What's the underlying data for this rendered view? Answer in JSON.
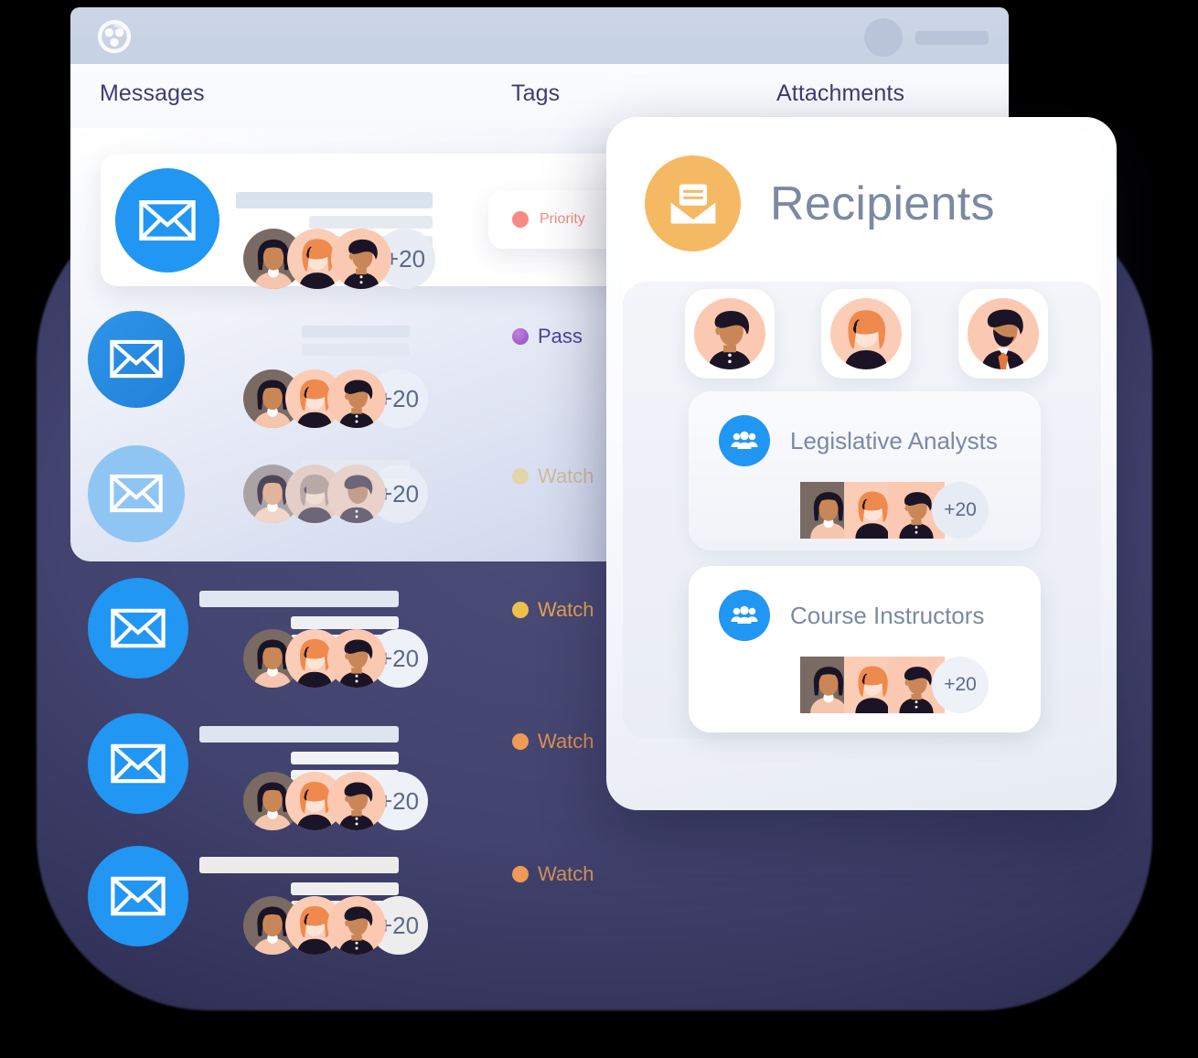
{
  "window": {
    "logo_icon": "group-logo-icon",
    "titlebar_avatar_icon": "user-avatar-placeholder",
    "titlebar_pill_icon": "name-placeholder-bar",
    "tabs": [
      {
        "label": "Messages",
        "icon": "tab-messages"
      },
      {
        "label": "Tags",
        "icon": "tab-tags"
      },
      {
        "label": "Attachments",
        "icon": "tab-attachments"
      }
    ]
  },
  "messages": [
    {
      "mail_icon": "envelope-icon",
      "overflow": "+20",
      "status": {
        "label": "Priority",
        "color": "#f98a82"
      }
    },
    {
      "mail_icon": "envelope-icon",
      "overflow": "+20",
      "status": {
        "label": "Pass",
        "color": "#a855c7"
      }
    },
    {
      "mail_icon": "envelope-icon",
      "overflow": "+20",
      "status": {
        "label": "Watch",
        "color": "#e8cf7f"
      }
    },
    {
      "mail_icon": "envelope-icon",
      "overflow": "+20",
      "status": {
        "label": "Watch",
        "color": "#edc04a"
      }
    },
    {
      "mail_icon": "envelope-icon",
      "overflow": "+20",
      "status": {
        "label": "Watch",
        "color": "#ef9a55"
      }
    },
    {
      "mail_icon": "envelope-icon",
      "overflow": "+20",
      "status": {
        "label": "Watch",
        "color": "#ef9a55"
      }
    }
  ],
  "recipients": {
    "title": "Recipients",
    "header_icon": "open-envelope-icon",
    "header_icon_color": "#f6b963",
    "people": [
      {
        "icon": "avatar-man-dark-hair"
      },
      {
        "icon": "avatar-woman-orange-bob"
      },
      {
        "icon": "avatar-man-beard-tie"
      }
    ],
    "groups": [
      {
        "name": "Legislative Analysts",
        "icon": "group-people-icon",
        "icon_color": "#2196f3",
        "overflow": "+20"
      },
      {
        "name": "Course Instructors",
        "icon": "group-people-icon",
        "icon_color": "#2196f3",
        "overflow": "+20"
      }
    ]
  },
  "colors": {
    "accent_blue": "#2196f3",
    "backdrop_navy": "#42436e",
    "tab_text": "#3e3c72",
    "muted_text": "#7b89a3"
  }
}
